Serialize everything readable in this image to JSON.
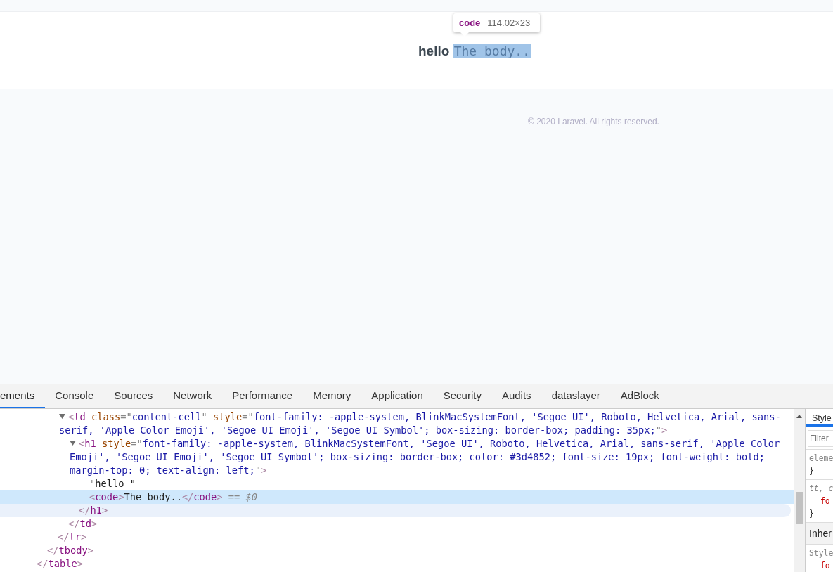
{
  "page": {
    "heading": {
      "text": "hello ",
      "code": "The body.."
    },
    "inspect_tooltip": {
      "tag": "code",
      "size": "114.02×23"
    },
    "footer": "© 2020 Laravel. All rights reserved."
  },
  "devtools": {
    "tabs": [
      {
        "label": "ements",
        "selected": true
      },
      {
        "label": "Console",
        "selected": false
      },
      {
        "label": "Sources",
        "selected": false
      },
      {
        "label": "Network",
        "selected": false
      },
      {
        "label": "Performance",
        "selected": false
      },
      {
        "label": "Memory",
        "selected": false
      },
      {
        "label": "Application",
        "selected": false
      },
      {
        "label": "Security",
        "selected": false
      },
      {
        "label": "Audits",
        "selected": false
      },
      {
        "label": "dataslayer",
        "selected": false
      },
      {
        "label": "AdBlock",
        "selected": false
      }
    ],
    "dom_tree": [
      {
        "selected": false,
        "hovered": false,
        "close": [
          {
            "kind": "bracket",
            "text": "</"
          },
          {
            "kind": "tag",
            "text": "table"
          },
          {
            "kind": "bracket",
            "text": ">"
          }
        ],
        "children": [
          {
            "selected": false,
            "hovered": false,
            "close": [
              {
                "kind": "bracket",
                "text": "</"
              },
              {
                "kind": "tag",
                "text": "tbody"
              },
              {
                "kind": "bracket",
                "text": ">"
              }
            ],
            "children": [
              {
                "selected": false,
                "hovered": false,
                "close": [
                  {
                    "kind": "bracket",
                    "text": "</"
                  },
                  {
                    "kind": "tag",
                    "text": "tr"
                  },
                  {
                    "kind": "bracket",
                    "text": ">"
                  }
                ],
                "children": [
                  {
                    "selected": false,
                    "hovered": false,
                    "expanded": true,
                    "open": [
                      {
                        "kind": "bracket",
                        "text": "<"
                      },
                      {
                        "kind": "tag",
                        "text": "td"
                      },
                      {
                        "kind": "attr",
                        "text": " class"
                      },
                      {
                        "kind": "punct",
                        "text": "=\""
                      },
                      {
                        "kind": "value",
                        "text": "content-cell"
                      },
                      {
                        "kind": "punct",
                        "text": "\""
                      },
                      {
                        "kind": "attr",
                        "text": " style"
                      },
                      {
                        "kind": "punct",
                        "text": "=\""
                      },
                      {
                        "kind": "value",
                        "text": "font-family: -apple-system, BlinkMacSystemFont, 'Segoe UI', Roboto, Helvetica, Arial, sans-serif, 'Apple Color Emoji', 'Segoe UI Emoji', 'Segoe UI Symbol'; box-sizing: border-box; padding: 35px;"
                      },
                      {
                        "kind": "punct",
                        "text": "\""
                      },
                      {
                        "kind": "bracket",
                        "text": ">"
                      }
                    ],
                    "close": [
                      {
                        "kind": "bracket",
                        "text": "</"
                      },
                      {
                        "kind": "tag",
                        "text": "td"
                      },
                      {
                        "kind": "bracket",
                        "text": ">"
                      }
                    ],
                    "children": [
                      {
                        "selected": false,
                        "hovered": true,
                        "expanded": true,
                        "open": [
                          {
                            "kind": "bracket",
                            "text": "<"
                          },
                          {
                            "kind": "tag",
                            "text": "h1"
                          },
                          {
                            "kind": "attr",
                            "text": " style"
                          },
                          {
                            "kind": "punct",
                            "text": "=\""
                          },
                          {
                            "kind": "value",
                            "text": "font-family: -apple-system, BlinkMacSystemFont, 'Segoe UI', Roboto, Helvetica, Arial, sans-serif, 'Apple Color Emoji', 'Segoe UI Emoji', 'Segoe UI Symbol'; box-sizing: border-box; color: #3d4852; font-size: 19px; font-weight: bold; margin-top: 0; text-align: left;"
                          },
                          {
                            "kind": "punct",
                            "text": "\""
                          },
                          {
                            "kind": "bracket",
                            "text": ">"
                          }
                        ],
                        "close": [
                          {
                            "kind": "bracket",
                            "text": "</"
                          },
                          {
                            "kind": "tag",
                            "text": "h1"
                          },
                          {
                            "kind": "bracket",
                            "text": ">"
                          }
                        ],
                        "children": [
                          {
                            "selected": false,
                            "open": [
                              {
                                "kind": "text",
                                "text": "\"hello \""
                              }
                            ]
                          },
                          {
                            "selected": true,
                            "open": [
                              {
                                "kind": "bracket",
                                "text": "<"
                              },
                              {
                                "kind": "tag",
                                "text": "code"
                              },
                              {
                                "kind": "bracket",
                                "text": ">"
                              },
                              {
                                "kind": "text",
                                "text": "The body.."
                              },
                              {
                                "kind": "bracket",
                                "text": "</"
                              },
                              {
                                "kind": "tag",
                                "text": "code"
                              },
                              {
                                "kind": "bracket",
                                "text": ">"
                              },
                              {
                                "kind": "marker",
                                "text": " == $0"
                              }
                            ]
                          }
                        ]
                      }
                    ]
                  }
                ]
              }
            ]
          }
        ]
      }
    ],
    "styles_pane": {
      "tab": {
        "label": "Style",
        "selected": true
      },
      "filter": {
        "placeholder": "Filter"
      },
      "sections": [
        {
          "kind": "rule",
          "lines": [
            {
              "kind": "selector",
              "text": "eleme"
            },
            {
              "kind": "brace",
              "text": "}"
            }
          ]
        },
        {
          "kind": "rule",
          "lines": [
            {
              "kind": "ua_selector",
              "text": "tt, c"
            },
            {
              "kind": "property",
              "text": "fo"
            },
            {
              "kind": "brace",
              "text": "}"
            }
          ]
        },
        {
          "kind": "header",
          "lines": [
            {
              "kind": "heading",
              "text": "Inher"
            }
          ]
        },
        {
          "kind": "rule",
          "lines": [
            {
              "kind": "origin",
              "text": "Style"
            },
            {
              "kind": "property",
              "text": "fo"
            }
          ]
        }
      ]
    }
  }
}
